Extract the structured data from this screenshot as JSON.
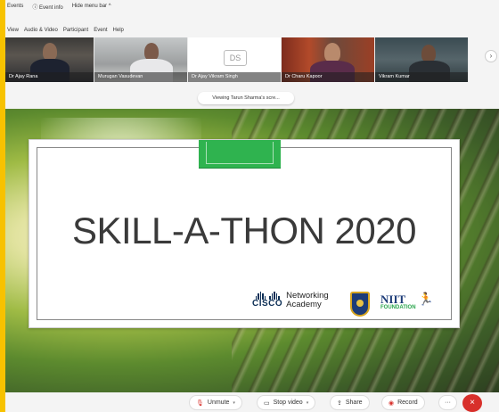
{
  "topbar": {
    "events": "Events",
    "event_info": "Event info",
    "hide_menu": "Hide menu bar ^"
  },
  "menu": [
    "View",
    "Audio & Video",
    "Participant",
    "Event",
    "Help"
  ],
  "participants": [
    {
      "name": "Dr Ajay Rana"
    },
    {
      "name": "Murugan Vasudevan"
    },
    {
      "name": "Dr Ajay Vikram Singh",
      "initials": "DS"
    },
    {
      "name": "Dr Charu Kapoor"
    },
    {
      "name": "Vikram Kumar"
    }
  ],
  "strip_next": "›",
  "viewing_banner": "Viewing Tarun Sharma's scre...",
  "slide": {
    "title": "SKILL-A-THON 2020",
    "cisco_label": "CISCO",
    "networking_line1": "Networking",
    "networking_line2": "Academy",
    "niit_label": "NIIT",
    "niit_sub": "FOUNDATION"
  },
  "toolbar": {
    "unmute": "Unmute",
    "stop_video": "Stop video",
    "share": "Share",
    "record": "Record",
    "more": "···",
    "leave": "×"
  },
  "colors": {
    "frame": "#f7c200",
    "slide_accent": "#2fb34f",
    "leave": "#d8302b",
    "cisco": "#0d2f56"
  }
}
